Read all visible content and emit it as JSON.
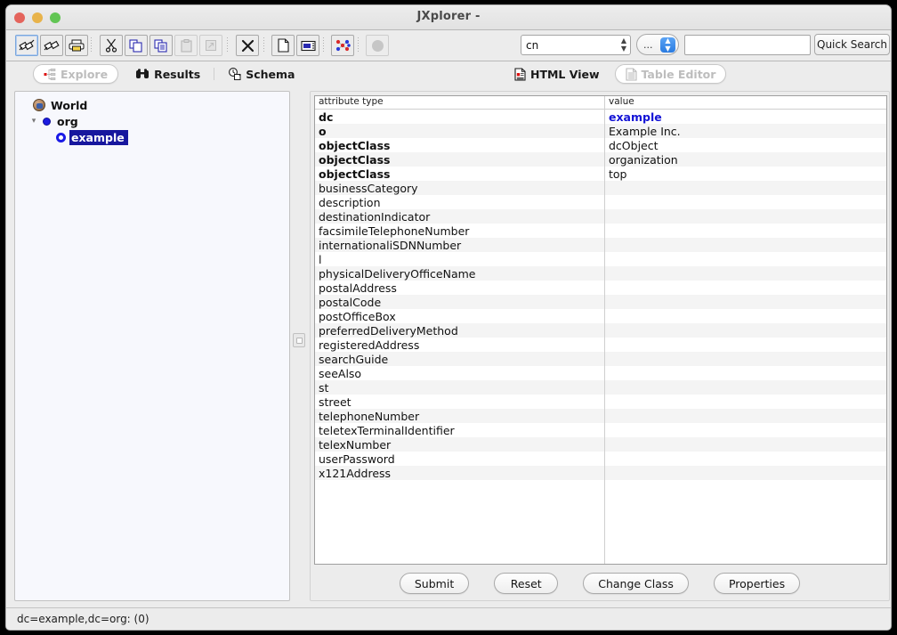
{
  "window": {
    "title": "JXplorer -",
    "controls": [
      "close",
      "minimize",
      "maximize"
    ]
  },
  "toolbar": {
    "buttons": [
      {
        "name": "connect-icon",
        "tip": "Connect",
        "selected": true,
        "disabled": false
      },
      {
        "name": "disconnect-icon",
        "tip": "Disconnect",
        "selected": false,
        "disabled": false
      },
      {
        "name": "print-icon",
        "tip": "Print",
        "selected": false,
        "disabled": false
      },
      {
        "name": "cut-icon",
        "tip": "Cut",
        "selected": false,
        "disabled": false
      },
      {
        "name": "copy-icon",
        "tip": "Copy",
        "selected": false,
        "disabled": false
      },
      {
        "name": "copy-dn-icon",
        "tip": "Copy DN",
        "selected": false,
        "disabled": false
      },
      {
        "name": "paste-icon",
        "tip": "Paste",
        "selected": false,
        "disabled": true
      },
      {
        "name": "paste-alias-icon",
        "tip": "Paste Alias",
        "selected": false,
        "disabled": true
      },
      {
        "name": "delete-icon",
        "tip": "Delete",
        "selected": false,
        "disabled": false
      },
      {
        "name": "new-entry-icon",
        "tip": "New Entry",
        "selected": false,
        "disabled": false
      },
      {
        "name": "rename-icon",
        "tip": "Rename",
        "selected": false,
        "disabled": false
      },
      {
        "name": "refresh-tree-icon",
        "tip": "Refresh Tree",
        "selected": false,
        "disabled": false
      },
      {
        "name": "stop-icon",
        "tip": "Stop",
        "selected": false,
        "disabled": true
      }
    ],
    "attribute_select": {
      "value": "cn"
    },
    "match_select": {
      "value": "..."
    },
    "search_input": {
      "value": "",
      "placeholder": ""
    },
    "quick_search_label": "Quick Search"
  },
  "left_tabs": [
    {
      "label": "Explore",
      "icon": "tree-icon",
      "active": true
    },
    {
      "label": "Results",
      "icon": "binoculars-icon",
      "active": false
    },
    {
      "label": "Schema",
      "icon": "schema-icon",
      "active": false
    }
  ],
  "right_tabs": [
    {
      "label": "HTML View",
      "icon": "html-doc-icon",
      "active": false
    },
    {
      "label": "Table Editor",
      "icon": "table-doc-icon",
      "active": true
    }
  ],
  "tree": {
    "nodes": [
      {
        "label": "World",
        "icon": "world-icon",
        "depth": 0,
        "twisty": "",
        "selected": false
      },
      {
        "label": "org",
        "icon": "blue-dot-icon",
        "depth": 1,
        "twisty": "v",
        "selected": false
      },
      {
        "label": "example",
        "icon": "blue-ring-icon",
        "depth": 2,
        "twisty": "",
        "selected": true
      }
    ]
  },
  "table": {
    "headers": [
      "attribute type",
      "value"
    ],
    "rows": [
      {
        "attribute": "dc",
        "value": "example",
        "bold": true,
        "value_style": "blue-bold"
      },
      {
        "attribute": "o",
        "value": "Example Inc.",
        "bold": true,
        "value_style": ""
      },
      {
        "attribute": "objectClass",
        "value": "dcObject",
        "bold": true,
        "value_style": ""
      },
      {
        "attribute": "objectClass",
        "value": "organization",
        "bold": true,
        "value_style": ""
      },
      {
        "attribute": "objectClass",
        "value": "top",
        "bold": true,
        "value_style": ""
      },
      {
        "attribute": "businessCategory",
        "value": "",
        "bold": false,
        "value_style": ""
      },
      {
        "attribute": "description",
        "value": "",
        "bold": false,
        "value_style": ""
      },
      {
        "attribute": "destinationIndicator",
        "value": "",
        "bold": false,
        "value_style": ""
      },
      {
        "attribute": "facsimileTelephoneNumber",
        "value": "",
        "bold": false,
        "value_style": ""
      },
      {
        "attribute": "internationaliSDNNumber",
        "value": "",
        "bold": false,
        "value_style": ""
      },
      {
        "attribute": "l",
        "value": "",
        "bold": false,
        "value_style": ""
      },
      {
        "attribute": "physicalDeliveryOfficeName",
        "value": "",
        "bold": false,
        "value_style": ""
      },
      {
        "attribute": "postalAddress",
        "value": "",
        "bold": false,
        "value_style": ""
      },
      {
        "attribute": "postalCode",
        "value": "",
        "bold": false,
        "value_style": ""
      },
      {
        "attribute": "postOfficeBox",
        "value": "",
        "bold": false,
        "value_style": ""
      },
      {
        "attribute": "preferredDeliveryMethod",
        "value": "",
        "bold": false,
        "value_style": ""
      },
      {
        "attribute": "registeredAddress",
        "value": "",
        "bold": false,
        "value_style": ""
      },
      {
        "attribute": "searchGuide",
        "value": "",
        "bold": false,
        "value_style": ""
      },
      {
        "attribute": "seeAlso",
        "value": "",
        "bold": false,
        "value_style": ""
      },
      {
        "attribute": "st",
        "value": "",
        "bold": false,
        "value_style": ""
      },
      {
        "attribute": "street",
        "value": "",
        "bold": false,
        "value_style": ""
      },
      {
        "attribute": "telephoneNumber",
        "value": "",
        "bold": false,
        "value_style": ""
      },
      {
        "attribute": "teletexTerminalIdentifier",
        "value": "",
        "bold": false,
        "value_style": ""
      },
      {
        "attribute": "telexNumber",
        "value": "",
        "bold": false,
        "value_style": ""
      },
      {
        "attribute": "userPassword",
        "value": "",
        "bold": false,
        "value_style": ""
      },
      {
        "attribute": "x121Address",
        "value": "",
        "bold": false,
        "value_style": ""
      }
    ]
  },
  "action_buttons": [
    {
      "label": "Submit",
      "name": "submit-button"
    },
    {
      "label": "Reset",
      "name": "reset-button"
    },
    {
      "label": "Change Class",
      "name": "change-class-button"
    },
    {
      "label": "Properties",
      "name": "properties-button"
    }
  ],
  "status_bar": {
    "text": "dc=example,dc=org: (0)"
  },
  "colors": {
    "selection_blue": "#17179e",
    "value_blue": "#1414d6",
    "window_bg": "#ececec",
    "tree_bg": "#f7f8fd",
    "table_alt_row": "#f4f4f4",
    "accent_blue": "#2a7be0"
  }
}
